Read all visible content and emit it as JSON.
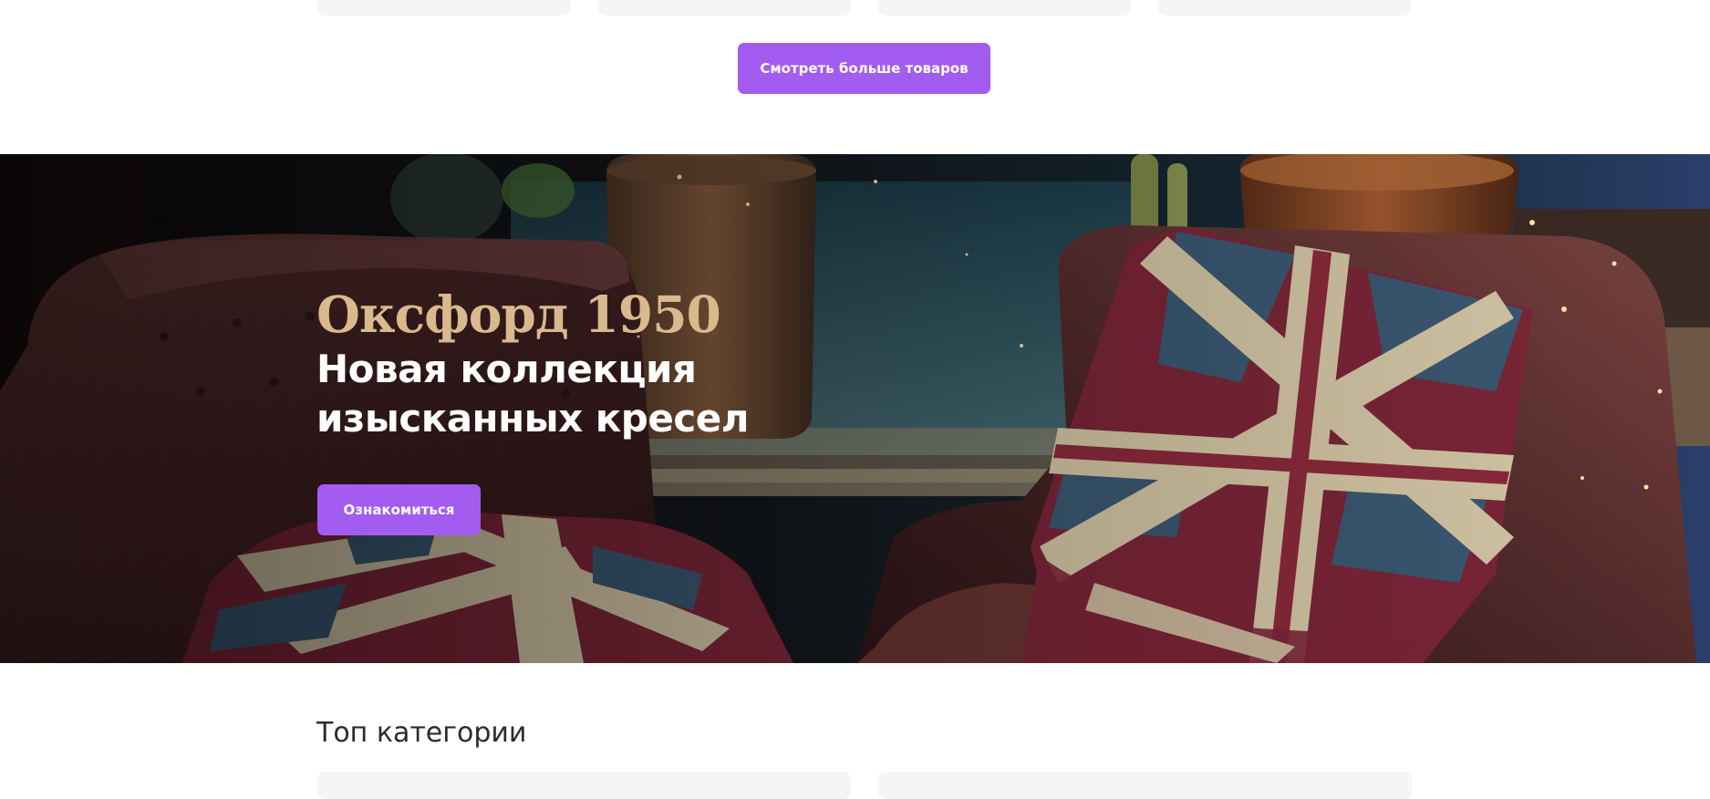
{
  "products": {
    "more_button_label": "Смотреть больше товаров"
  },
  "promo": {
    "title": "Оксфорд 1950",
    "subtitle": "Новая коллекция изысканных кресел",
    "cta_label": "Ознакомиться",
    "colors": {
      "title": "#d9b98d",
      "button": "#a35cf0"
    }
  },
  "categories": {
    "heading": "Топ категории"
  }
}
